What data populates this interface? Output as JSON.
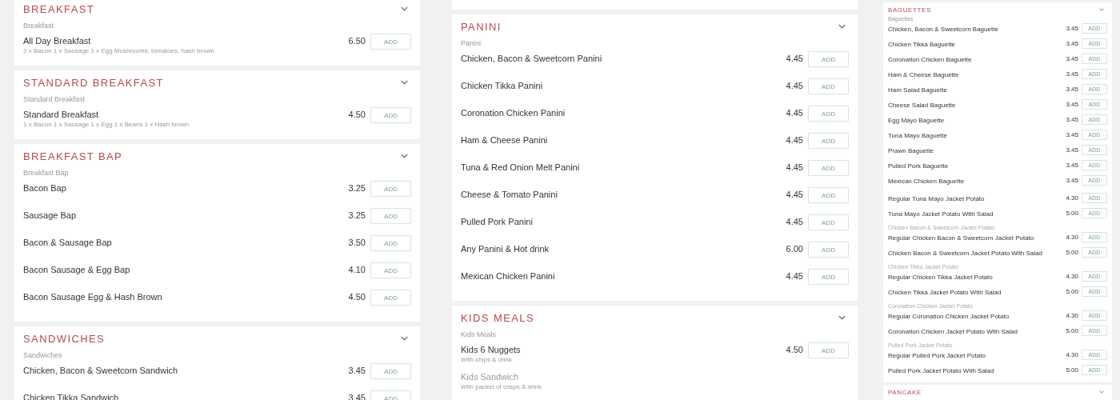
{
  "columns": [
    {
      "panels": [
        {
          "sections": [
            {
              "kind": "section",
              "title": "BREAKFAST",
              "expanded": true,
              "subtitle": "Breakfast",
              "items": [
                {
                  "kind": "dish",
                  "name": "All Day Breakfast",
                  "description": "2 x Bacon 1 x Sausage 1 x Egg Mushrooms, tomatoes, hash brown",
                  "price": "6.50",
                  "button": "ADD",
                  "available": true
                }
              ]
            },
            {
              "kind": "section",
              "title": "STANDARD BREAKFAST",
              "expanded": true,
              "subtitle": "Standard Breakfast",
              "items": [
                {
                  "kind": "dish",
                  "name": "Standard Breakfast",
                  "description": "1 x Bacon 1 x Sausage 1 x Egg 1 x Beans 1 x Hash brown",
                  "price": "4.50",
                  "button": "ADD",
                  "available": true
                }
              ]
            },
            {
              "kind": "section",
              "title": "BREAKFAST BAP",
              "expanded": true,
              "subtitle": "Breakfast Bap",
              "items": [
                {
                  "kind": "dish",
                  "name": "Bacon Bap",
                  "price": "3.25",
                  "button": "ADD",
                  "available": true
                },
                {
                  "kind": "dish",
                  "name": "Sausage Bap",
                  "price": "3.25",
                  "button": "ADD",
                  "available": true
                },
                {
                  "kind": "dish",
                  "name": "Bacon & Sausage Bap",
                  "price": "3.50",
                  "button": "ADD",
                  "available": true
                },
                {
                  "kind": "dish",
                  "name": "Bacon Sausage & Egg Bap",
                  "price": "4.10",
                  "button": "ADD",
                  "available": true
                },
                {
                  "kind": "dish",
                  "name": "Bacon Sausage Egg & Hash Brown",
                  "price": "4.50",
                  "button": "ADD",
                  "available": true
                }
              ]
            },
            {
              "kind": "section",
              "title": "SANDWICHES",
              "expanded": true,
              "subtitle": "Sandwiches",
              "items": [
                {
                  "kind": "dish",
                  "name": "Chicken, Bacon & Sweetcorn Sandwich",
                  "price": "3.45",
                  "button": "ADD",
                  "available": true
                },
                {
                  "kind": "dish",
                  "name": "Chicken Tikka Sandwich",
                  "price": "3.45",
                  "button": "ADD",
                  "available": true
                }
              ]
            }
          ]
        }
      ]
    },
    {
      "panels": [
        {
          "sections": [
            {
              "kind": "cut-off"
            },
            {
              "kind": "section",
              "title": "PANINI",
              "expanded": true,
              "subtitle": "Panini",
              "items": [
                {
                  "kind": "dish",
                  "name": "Chicken, Bacon & Sweetcorn Panini",
                  "price": "4.45",
                  "button": "ADD",
                  "available": true
                },
                {
                  "kind": "dish",
                  "name": "Chicken Tikka Panini",
                  "price": "4.45",
                  "button": "ADD",
                  "available": true
                },
                {
                  "kind": "dish",
                  "name": "Coronation Chicken Panini",
                  "price": "4.45",
                  "button": "ADD",
                  "available": true
                },
                {
                  "kind": "dish",
                  "name": "Ham & Cheese Panini",
                  "price": "4.45",
                  "button": "ADD",
                  "available": true
                },
                {
                  "kind": "dish",
                  "name": "Tuna & Red Onion Melt Panini",
                  "price": "4.45",
                  "button": "ADD",
                  "available": true
                },
                {
                  "kind": "dish",
                  "name": "Cheese & Tomato Panini",
                  "price": "4.45",
                  "button": "ADD",
                  "available": true
                },
                {
                  "kind": "dish",
                  "name": "Pulled Pork Panini",
                  "price": "4.45",
                  "button": "ADD",
                  "available": true
                },
                {
                  "kind": "dish",
                  "name": "Any Panini & Hot drink",
                  "price": "6.00",
                  "button": "ADD",
                  "available": true
                },
                {
                  "kind": "dish",
                  "name": "Mexican Chicken Panini",
                  "price": "4.45",
                  "button": "ADD",
                  "available": true
                }
              ]
            },
            {
              "kind": "section",
              "title": "KIDS MEALS",
              "expanded": true,
              "subtitle": "Kids Meals",
              "items": [
                {
                  "kind": "dish",
                  "name": "Kids 6 Nuggets",
                  "description": "With chips & drink",
                  "price": "4.50",
                  "button": "ADD",
                  "available": true
                },
                {
                  "kind": "dish",
                  "name": "Kids Sandwich",
                  "description": "With packet of crisps & drink",
                  "available": false
                }
              ]
            }
          ]
        }
      ]
    },
    {
      "panels": [
        {
          "sections": [
            {
              "kind": "cut-off"
            },
            {
              "kind": "section",
              "title": "BAGUETTES",
              "expanded": true,
              "subtitle": "Baguettes",
              "items": [
                {
                  "kind": "dish",
                  "name": "Chicken, Bacon & Sweetcorn Baguette",
                  "price": "3.45",
                  "button": "ADD",
                  "available": true
                },
                {
                  "kind": "dish",
                  "name": "Chicken Tikka Baguette",
                  "price": "3.45",
                  "button": "ADD",
                  "available": true
                },
                {
                  "kind": "dish",
                  "name": "Coronation Chicken Baguette",
                  "price": "3.45",
                  "button": "ADD",
                  "available": true
                },
                {
                  "kind": "dish",
                  "name": "Ham & Cheese Baguette",
                  "price": "3.45",
                  "button": "ADD",
                  "available": true
                },
                {
                  "kind": "dish",
                  "name": "Ham Salad Baguette",
                  "price": "3.45",
                  "button": "ADD",
                  "available": true
                },
                {
                  "kind": "dish",
                  "name": "Cheese Salad Baguette",
                  "price": "3.45",
                  "button": "ADD",
                  "available": true
                },
                {
                  "kind": "dish",
                  "name": "Egg Mayo Baguette",
                  "price": "3.45",
                  "button": "ADD",
                  "available": true
                },
                {
                  "kind": "dish",
                  "name": "Tuna Mayo Baguette",
                  "price": "3.45",
                  "button": "ADD",
                  "available": true
                },
                {
                  "kind": "dish",
                  "name": "Prawn Baguette",
                  "price": "3.45",
                  "button": "ADD",
                  "available": true
                },
                {
                  "kind": "dish",
                  "name": "Pulled Pork Baguette",
                  "price": "3.45",
                  "button": "ADD",
                  "available": true
                },
                {
                  "kind": "dish",
                  "name": "Mexican Chicken Baguette",
                  "price": "3.45",
                  "button": "ADD",
                  "available": true
                }
              ]
            }
          ]
        },
        {
          "sections": [
            {
              "kind": "section",
              "items": [
                {
                  "kind": "dish",
                  "name": "Regular Tuna Mayo Jacket Potato",
                  "price": "4.30",
                  "button": "ADD",
                  "available": true
                },
                {
                  "kind": "dish",
                  "name": "Tuna Mayo Jacket Potato With Salad",
                  "price": "5.00",
                  "button": "ADD",
                  "available": true
                },
                {
                  "kind": "group",
                  "label": "Chicken Bacon & Sweetcorn Jacket Potato"
                },
                {
                  "kind": "dish",
                  "name": "Regular Chicken Bacon & Sweetcorn Jacket Potato",
                  "price": "4.30",
                  "button": "ADD",
                  "available": true
                },
                {
                  "kind": "dish",
                  "name": "Chicken Bacon & Sweetcorn Jacket Potato With Salad",
                  "price": "5.00",
                  "button": "ADD",
                  "available": true
                },
                {
                  "kind": "group",
                  "label": "Chicken Tikka Jacket Potato"
                },
                {
                  "kind": "dish",
                  "name": "Regular Chicken Tikka Jacket Potato",
                  "price": "4.30",
                  "button": "ADD",
                  "available": true
                },
                {
                  "kind": "dish",
                  "name": "Chicken Tikka Jacket Potato With Salad",
                  "price": "5.00",
                  "button": "ADD",
                  "available": true
                },
                {
                  "kind": "group",
                  "label": "Coronation Chicken Jacket Potato"
                },
                {
                  "kind": "dish",
                  "name": "Regular Coronation Chicken Jacket Potato",
                  "price": "4.30",
                  "button": "ADD",
                  "available": true
                },
                {
                  "kind": "dish",
                  "name": "Coronation Chicken Jacket Potato With Salad",
                  "price": "5.00",
                  "button": "ADD",
                  "available": true
                },
                {
                  "kind": "group",
                  "label": "Pulled Pork Jacket Potato"
                },
                {
                  "kind": "dish",
                  "name": "Regular Pulled Pork Jacket Potato",
                  "price": "4.30",
                  "button": "ADD",
                  "available": true
                },
                {
                  "kind": "dish",
                  "name": "Pulled Pork Jacket Potato With Salad",
                  "price": "5.00",
                  "button": "ADD",
                  "available": true
                }
              ]
            },
            {
              "kind": "section",
              "title": "PANCAKE",
              "expanded": true
            }
          ]
        }
      ]
    }
  ]
}
